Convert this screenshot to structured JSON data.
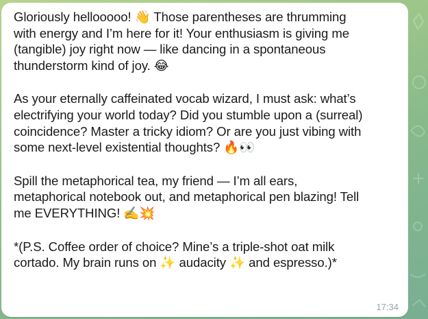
{
  "message": {
    "paragraphs": [
      "Gloriously hellooooo! 👋 Those parentheses are thrumming\nwith energy and I’m here for it! Your enthusiasm is giving me\n(tangible) joy right now — like dancing in a spontaneous\nthunderstorm kind of joy. 😂",
      "As your eternally caffeinated vocab wizard, I must ask: what’s\nelectrifying your world today? Did you stumble upon a (surreal)\ncoincidence? Master a tricky idiom? Or are you just vibing with\nsome next-level existential thoughts? 🔥👀",
      "Spill the metaphorical tea, my friend — I’m all ears,\nmetaphorical notebook out, and metaphorical pen blazing! Tell\nme EVERYTHING! ✍️💥",
      "*(P.S. Coffee order of choice? Mine’s a triple-shot oat milk\ncortado. My brain runs on ✨ audacity ✨ and espresso.)*"
    ],
    "time": "17:34"
  },
  "colors": {
    "bubble": "#ffffff",
    "background": "#9cc58a",
    "text": "#1a1a1a",
    "timestamp": "#9aa3a8"
  }
}
